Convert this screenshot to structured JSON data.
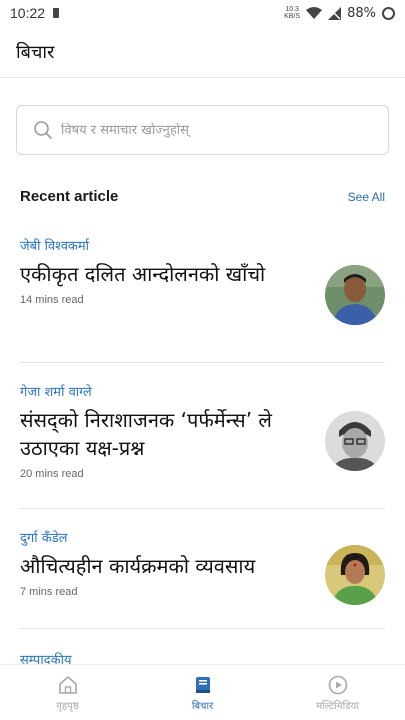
{
  "status_bar": {
    "time": "10:22",
    "net_rate_top": "10.3",
    "net_rate_bottom": "KB/S",
    "battery": "88%"
  },
  "app_bar": {
    "title": "बिचार"
  },
  "search": {
    "placeholder": "विषय र समाचार खोज्नुहोस्"
  },
  "section": {
    "title": "Recent article",
    "see_all": "See All"
  },
  "articles": [
    {
      "author": "जेबी विश्वकर्मा",
      "headline": "एकीकृत दलित आन्दोलनको खाँचो",
      "read_time": "14 mins read"
    },
    {
      "author": "गेजा शर्मा वाग्ले",
      "headline": "संसद्को निराशाजनक ‘पर्फर्मेन्स’ ले उठाएका यक्ष-प्रश्न",
      "read_time": "20 mins read"
    },
    {
      "author": "दुर्गा कँडेल",
      "headline": "औचित्यहीन कार्यक्रमको व्यवसाय",
      "read_time": "7 mins read"
    }
  ],
  "next_section": {
    "label": "सम्पादकीय"
  },
  "bottom_nav": [
    {
      "label": "गृहपृष्ठ",
      "icon": "home-icon",
      "active": false
    },
    {
      "label": "बिचार",
      "icon": "book-icon",
      "active": true
    },
    {
      "label": "मल्टिमिडिया",
      "icon": "play-circle-icon",
      "active": false
    }
  ],
  "colors": {
    "accent": "#2f6fb5",
    "author": "#2a74c4",
    "link": "#2b6cb0"
  }
}
